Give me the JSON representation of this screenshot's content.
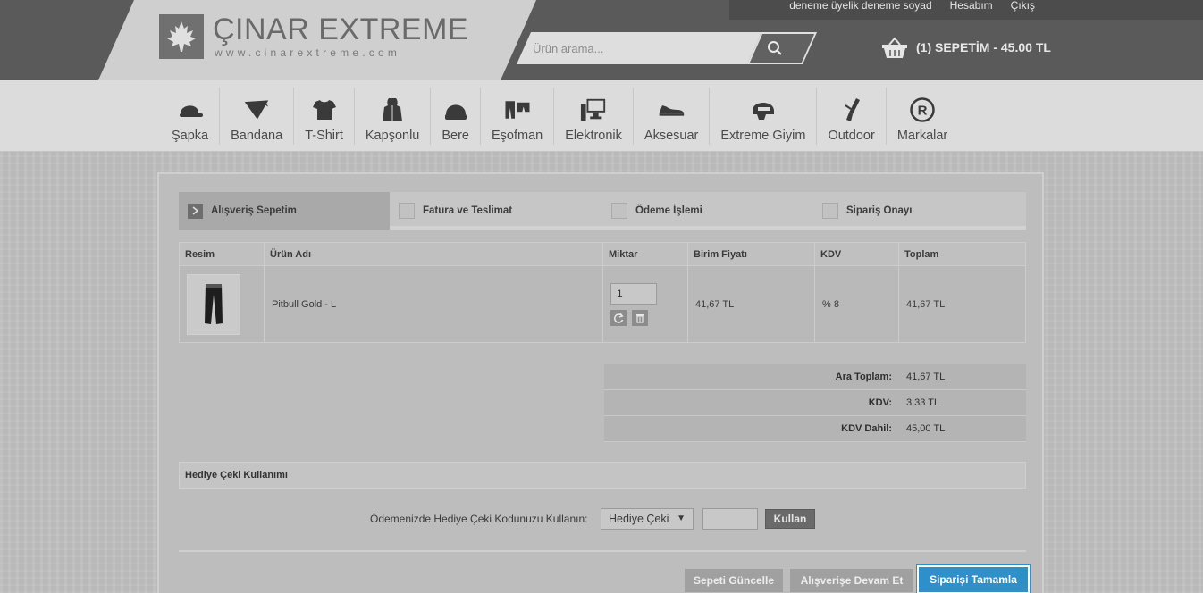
{
  "header": {
    "logo_title": "ÇINAR EXTREME",
    "logo_url": "www.cinarextreme.com",
    "user_links": [
      "deneme üyelik deneme soyad",
      "Hesabım",
      "Çıkış"
    ],
    "search_placeholder": "Ürün arama...",
    "cart_label": "(1) SEPETİM - 45.00 TL"
  },
  "nav": [
    {
      "label": "Şapka",
      "icon": "cap-icon"
    },
    {
      "label": "Bandana",
      "icon": "bandana-icon"
    },
    {
      "label": "T-Shirt",
      "icon": "tshirt-icon"
    },
    {
      "label": "Kapşonlu",
      "icon": "hoodie-icon"
    },
    {
      "label": "Bere",
      "icon": "beanie-icon"
    },
    {
      "label": "Eşofman",
      "icon": "tracksuit-icon"
    },
    {
      "label": "Elektronik",
      "icon": "computer-icon"
    },
    {
      "label": "Aksesuar",
      "icon": "sneaker-icon"
    },
    {
      "label": "Extreme Giyim",
      "icon": "helmet-icon"
    },
    {
      "label": "Outdoor",
      "icon": "knife-icon"
    },
    {
      "label": "Markalar",
      "icon": "registered-icon"
    }
  ],
  "steps": [
    "Alışveriş Sepetim",
    "Fatura ve Teslimat",
    "Ödeme İşlemi",
    "Sipariş Onayı"
  ],
  "table": {
    "headers": [
      "Resim",
      "Ürün Adı",
      "Miktar",
      "Birim Fiyatı",
      "KDV",
      "Toplam"
    ],
    "row": {
      "name": "Pitbull Gold - L",
      "qty": "1",
      "unit_price": "41,67 TL",
      "vat": "% 8",
      "total": "41,67 TL"
    }
  },
  "totals": [
    {
      "label": "Ara Toplam:",
      "value": "41,67 TL"
    },
    {
      "label": "KDV:",
      "value": "3,33 TL"
    },
    {
      "label": "KDV Dahil:",
      "value": "45,00 TL"
    }
  ],
  "gift": {
    "heading": "Hediye Çeki Kullanımı",
    "label": "Ödemenizde Hediye Çeki Kodunuzu Kullanın:",
    "select_value": "Hediye Çeki",
    "button": "Kullan"
  },
  "actions": {
    "update": "Sepeti Güncelle",
    "continue": "Alışverişe Devam Et",
    "complete": "Siparişi Tamamla"
  },
  "colors": {
    "accent": "#2f8fc8"
  }
}
